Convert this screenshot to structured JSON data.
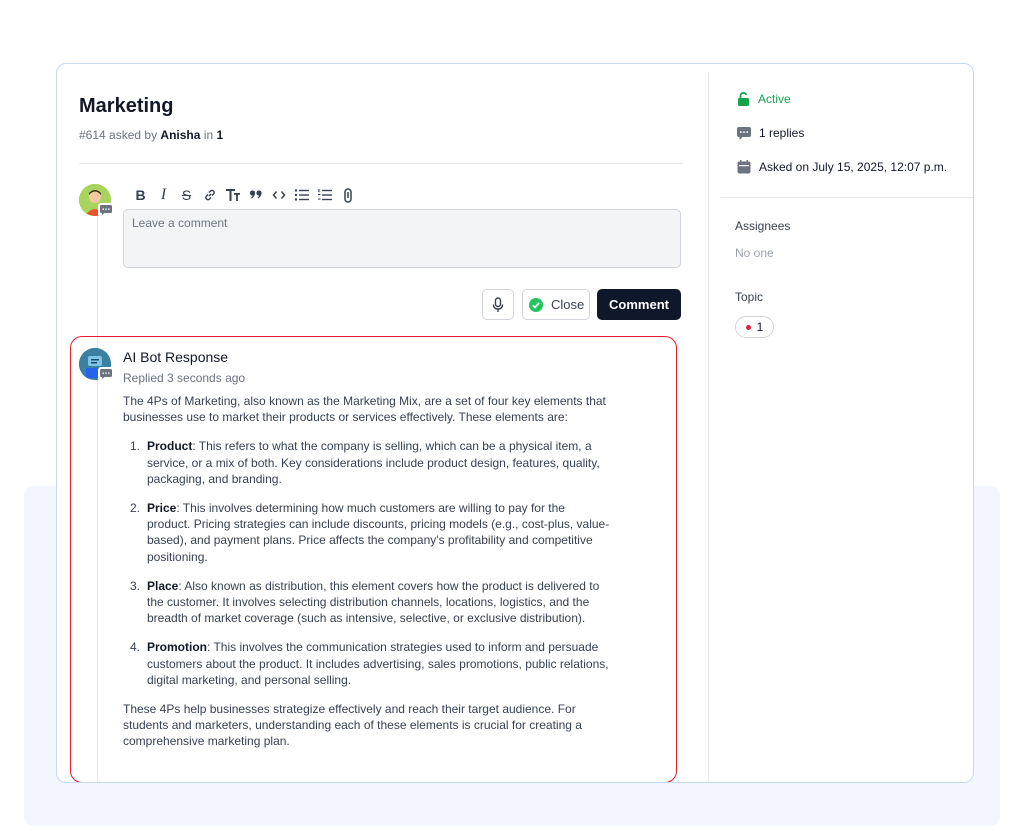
{
  "issue": {
    "title": "Marketing",
    "number": "#614",
    "asked_by_text": "asked by",
    "author": "Anisha",
    "in_text": "in",
    "topic_ref": "1"
  },
  "editor": {
    "placeholder": "Leave a comment",
    "toolbar": [
      "bold",
      "italic",
      "strikethrough",
      "link",
      "heading",
      "quote",
      "code",
      "bullet-list",
      "numbered-list",
      "attachment"
    ],
    "close_label": "Close",
    "comment_label": "Comment"
  },
  "ai_response": {
    "name": "AI Bot Response",
    "replied": "Replied 3 seconds ago",
    "intro": "The 4Ps of Marketing, also known as the Marketing Mix, are a set of four key elements that businesses use to market their products or services effectively. These elements are:",
    "items": [
      {
        "num": "1.",
        "term": "Product",
        "text": ": This refers to what the company is selling, which can be a physical item, a service, or a mix of both. Key considerations include product design, features, quality, packaging, and branding."
      },
      {
        "num": "2.",
        "term": "Price",
        "text": ": This involves determining how much customers are willing to pay for the product. Pricing strategies can include discounts, pricing models (e.g., cost-plus, value-based), and payment plans. Price affects the company's profitability and competitive positioning."
      },
      {
        "num": "3.",
        "term": "Place",
        "text": ": Also known as distribution, this element covers how the product is delivered to the customer. It involves selecting distribution channels, locations, logistics, and the breadth of market coverage (such as intensive, selective, or exclusive distribution)."
      },
      {
        "num": "4.",
        "term": "Promotion",
        "text": ": This involves the communication strategies used to inform and persuade customers about the product. It includes advertising, sales promotions, public relations, digital marketing, and personal selling."
      }
    ],
    "outro": "These 4Ps help businesses strategize effectively and reach their target audience. For students and marketers, understanding each of these elements is crucial for creating a comprehensive marketing plan."
  },
  "sidebar": {
    "status": "Active",
    "replies": "1 replies",
    "asked_on": "Asked on July 15, 2025, 12:07 p.m.",
    "assignees_label": "Assignees",
    "assignees_value": "No one",
    "topic_label": "Topic",
    "topic_value": "1"
  },
  "colors": {
    "active_green": "#16a34a",
    "primary_dark": "#0f172a",
    "highlight_red": "#e11d2e",
    "card_border": "#c8d7f3"
  }
}
